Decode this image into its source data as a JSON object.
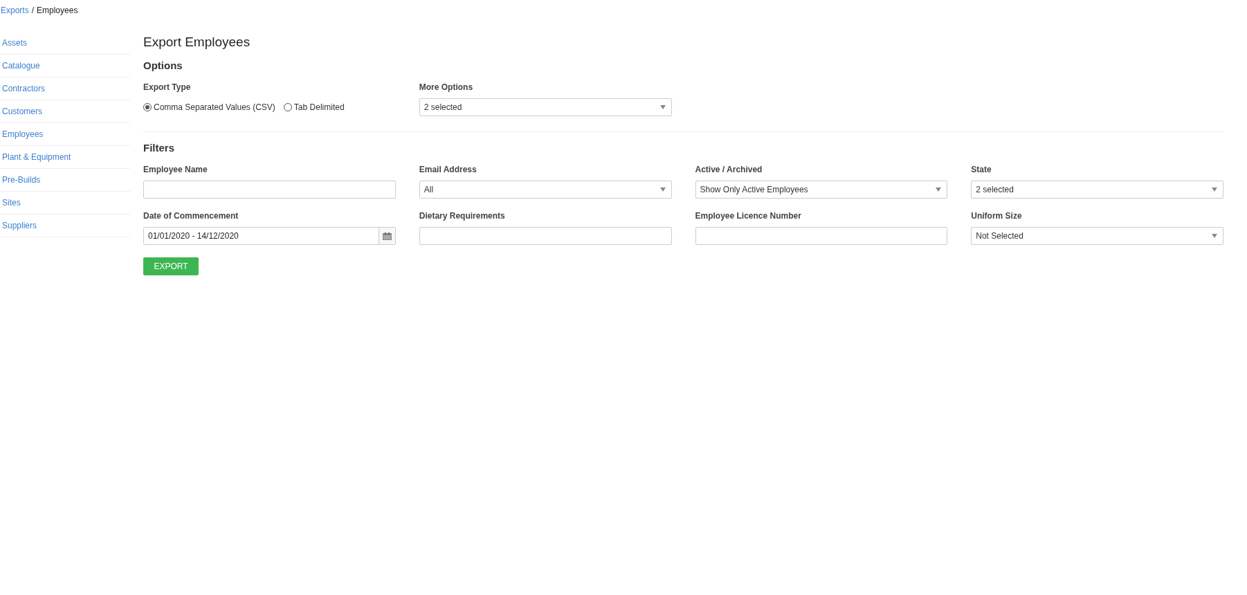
{
  "breadcrumb": {
    "link": "Exports",
    "separator": "/",
    "current": "Employees"
  },
  "sidebar": {
    "items": [
      {
        "label": "Assets"
      },
      {
        "label": "Catalogue"
      },
      {
        "label": "Contractors"
      },
      {
        "label": "Customers"
      },
      {
        "label": "Employees"
      },
      {
        "label": "Plant & Equipment"
      },
      {
        "label": "Pre-Builds"
      },
      {
        "label": "Sites"
      },
      {
        "label": "Suppliers"
      }
    ]
  },
  "title": "Export Employees",
  "options": {
    "heading": "Options",
    "export_type": {
      "label": "Export Type",
      "choices": [
        {
          "label": "Comma Separated Values (CSV)",
          "selected": true
        },
        {
          "label": "Tab Delimited",
          "selected": false
        }
      ]
    },
    "more_options": {
      "label": "More Options",
      "kind": "select",
      "value": "2 selected"
    }
  },
  "filters": {
    "heading": "Filters",
    "fields": [
      {
        "label": "Employee Name",
        "kind": "text"
      },
      {
        "label": "Email Address",
        "kind": "select",
        "value": "All"
      },
      {
        "label": "Active / Archived",
        "kind": "select",
        "value": "Show Only Active Employees"
      },
      {
        "label": "State",
        "kind": "select",
        "value": "2 selected"
      },
      {
        "label": "Date of Commencement",
        "kind": "date",
        "value": "01/01/2020 - 14/12/2020"
      },
      {
        "label": "Dietary Requirements",
        "kind": "text"
      },
      {
        "label": "Employee Licence Number",
        "kind": "text"
      },
      {
        "label": "Uniform Size",
        "kind": "select",
        "value": "Not Selected"
      }
    ]
  },
  "export_button": "EXPORT"
}
